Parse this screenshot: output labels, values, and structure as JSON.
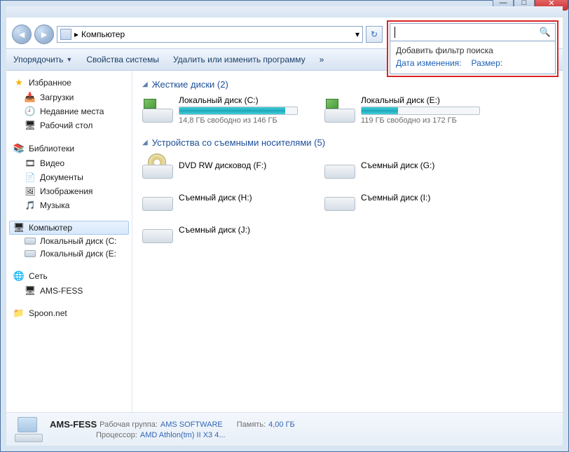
{
  "window": {
    "controls": {
      "min": "—",
      "max": "□",
      "close": "✕"
    }
  },
  "address": {
    "label": "Компьютер",
    "dropdown": "▾",
    "chevron": "▸",
    "refresh": "↻"
  },
  "search": {
    "value": "",
    "placeholder": "",
    "dropdown_header": "Добавить фильтр поиска",
    "filter_date": "Дата изменения:",
    "filter_size": "Размер:"
  },
  "toolbar": {
    "organize": "Упорядочить",
    "properties": "Свойства системы",
    "uninstall": "Удалить или изменить программу",
    "more": "»"
  },
  "sidebar": {
    "favorites": {
      "label": "Избранное",
      "items": [
        "Загрузки",
        "Недавние места",
        "Рабочий стол"
      ]
    },
    "libraries": {
      "label": "Библиотеки",
      "items": [
        "Видео",
        "Документы",
        "Изображения",
        "Музыка"
      ]
    },
    "computer": {
      "label": "Компьютер",
      "items": [
        "Локальный диск (C:",
        "Локальный диск (E:"
      ]
    },
    "network": {
      "label": "Сеть",
      "items": [
        "AMS-FESS"
      ]
    },
    "extra": {
      "items": [
        "Spoon.net"
      ]
    }
  },
  "content": {
    "group_hdd": {
      "title": "Жесткие диски (2)"
    },
    "hdd": [
      {
        "name": "Локальный диск (C:)",
        "sub": "14,8 ГБ свободно из 146 ГБ",
        "fill": 90
      },
      {
        "name": "Локальный диск (E:)",
        "sub": "119 ГБ свободно из 172 ГБ",
        "fill": 31
      }
    ],
    "group_removable": {
      "title": "Устройства со съемными носителями (5)"
    },
    "removable": [
      {
        "name": "DVD RW дисковод (F:)",
        "type": "dvd"
      },
      {
        "name": "Съемный диск (G:)",
        "type": "drive"
      },
      {
        "name": "Съемный диск (H:)",
        "type": "drive"
      },
      {
        "name": "Съемный диск (I:)",
        "type": "drive"
      },
      {
        "name": "Съемный диск (J:)",
        "type": "drive"
      }
    ]
  },
  "status": {
    "name": "AMS-FESS",
    "workgroup_k": "Рабочая группа:",
    "workgroup_v": "AMS SOFTWARE",
    "cpu_k": "Процессор:",
    "cpu_v": "AMD Athlon(tm) II X3 4...",
    "mem_k": "Память:",
    "mem_v": "4,00 ГБ"
  }
}
